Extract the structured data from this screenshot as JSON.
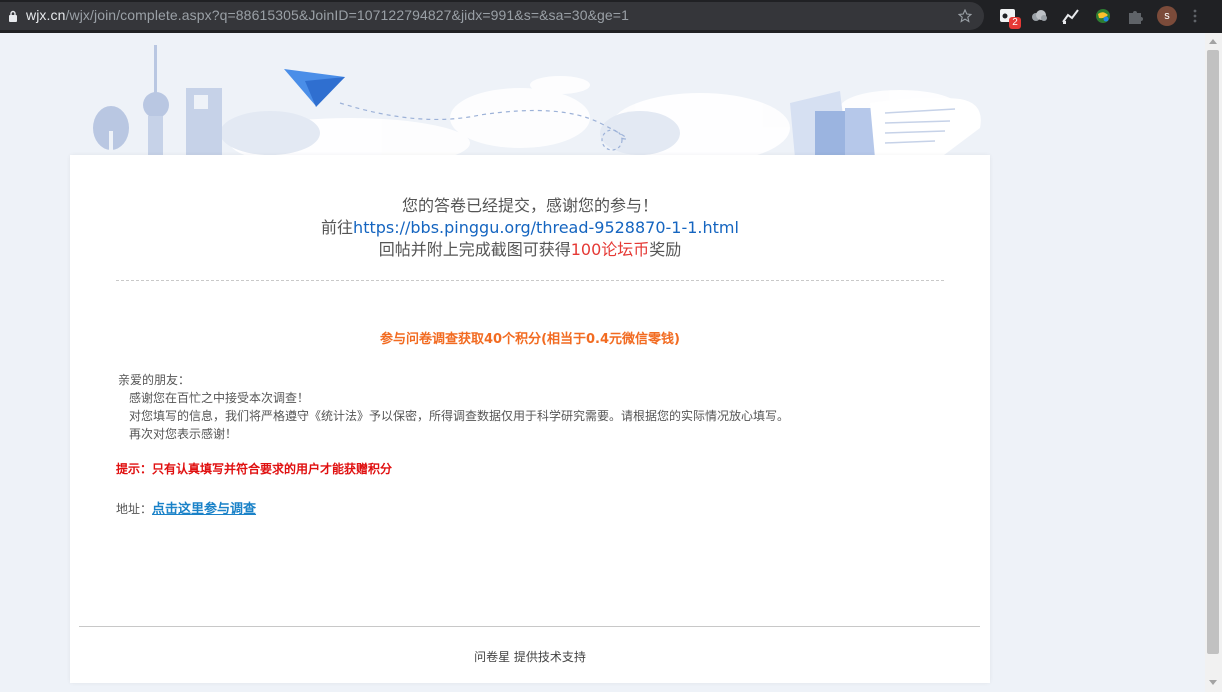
{
  "browser": {
    "url_host": "wjx.cn",
    "url_path": "/wjx/join/complete.aspx?q=88615305&JoinID=107122794827&jidx=991&s=&sa=30&ge=1",
    "extension_badge": "2",
    "avatar_initial": "s"
  },
  "message": {
    "line1": "您的答卷已经提交，感谢您的参与！",
    "line2_prefix": "前往",
    "line2_link": "https://bbs.pinggu.org/thread-9528870-1-1.html",
    "line3_prefix": "回帖并附上完成截图可获得",
    "line3_highlight": "100论坛币",
    "line3_suffix": "奖励"
  },
  "reward_title": "参与问卷调查获取40个积分(相当于0.4元微信零钱)",
  "letter": {
    "greeting": "亲爱的朋友：",
    "p1": "感谢您在百忙之中接受本次调查！",
    "p2": "对您填写的信息，我们将严格遵守《统计法》予以保密，所得调查数据仅用于科学研究需要。请根据您的实际情况放心填写。",
    "p3": "再次对您表示感谢！"
  },
  "tip": "提示：只有认真填写并符合要求的用户才能获赠积分",
  "address": {
    "label": "地址：",
    "link_text": "点击这里参与调查"
  },
  "footer": {
    "brand": "问卷星",
    "text": " 提供技术支持"
  },
  "colors": {
    "link": "#1565c0",
    "highlight_red": "#e53935",
    "reward_orange": "#f26b21",
    "tip_red": "#e01010"
  }
}
